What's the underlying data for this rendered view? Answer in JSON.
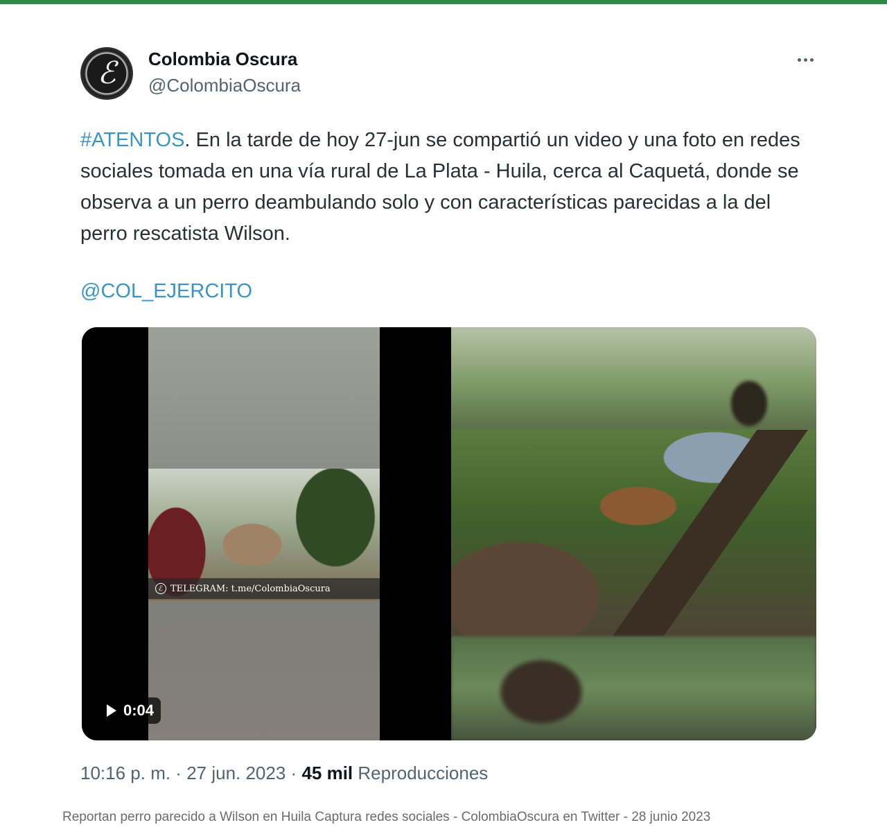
{
  "author": {
    "name": "Colombia Oscura",
    "handle": "@ColombiaOscura",
    "avatar_glyph": "ℰ"
  },
  "tweet": {
    "hashtag": "#ATENTOS",
    "body": ". En la tarde de hoy 27-jun se compartió un video y una foto en redes sociales tomada en una vía rural de La Plata - Huila, cerca al Caquetá, donde se observa a un perro deambulando solo y con características parecidas a la del perro rescatista Wilson.",
    "mention": "@COL_EJERCITO"
  },
  "video": {
    "duration": "0:04",
    "watermark": "TELEGRAM: t.me/ColombiaOscura",
    "telegram_icon": "ℰ"
  },
  "meta": {
    "time": "10:16 p. m.",
    "separator": " · ",
    "date": "27 jun. 2023",
    "views_count": "45 mil",
    "views_label": "Reproducciones"
  },
  "caption": "Reportan perro parecido a Wilson en Huila Captura redes sociales - ColombiaOscura en Twitter - 28 junio 2023",
  "icons": {
    "more": "more-horizontal-icon",
    "play": "play-icon"
  },
  "colors": {
    "accent_bar": "#2e8b46",
    "link": "#3a94c6",
    "secondary_text": "#536471"
  }
}
